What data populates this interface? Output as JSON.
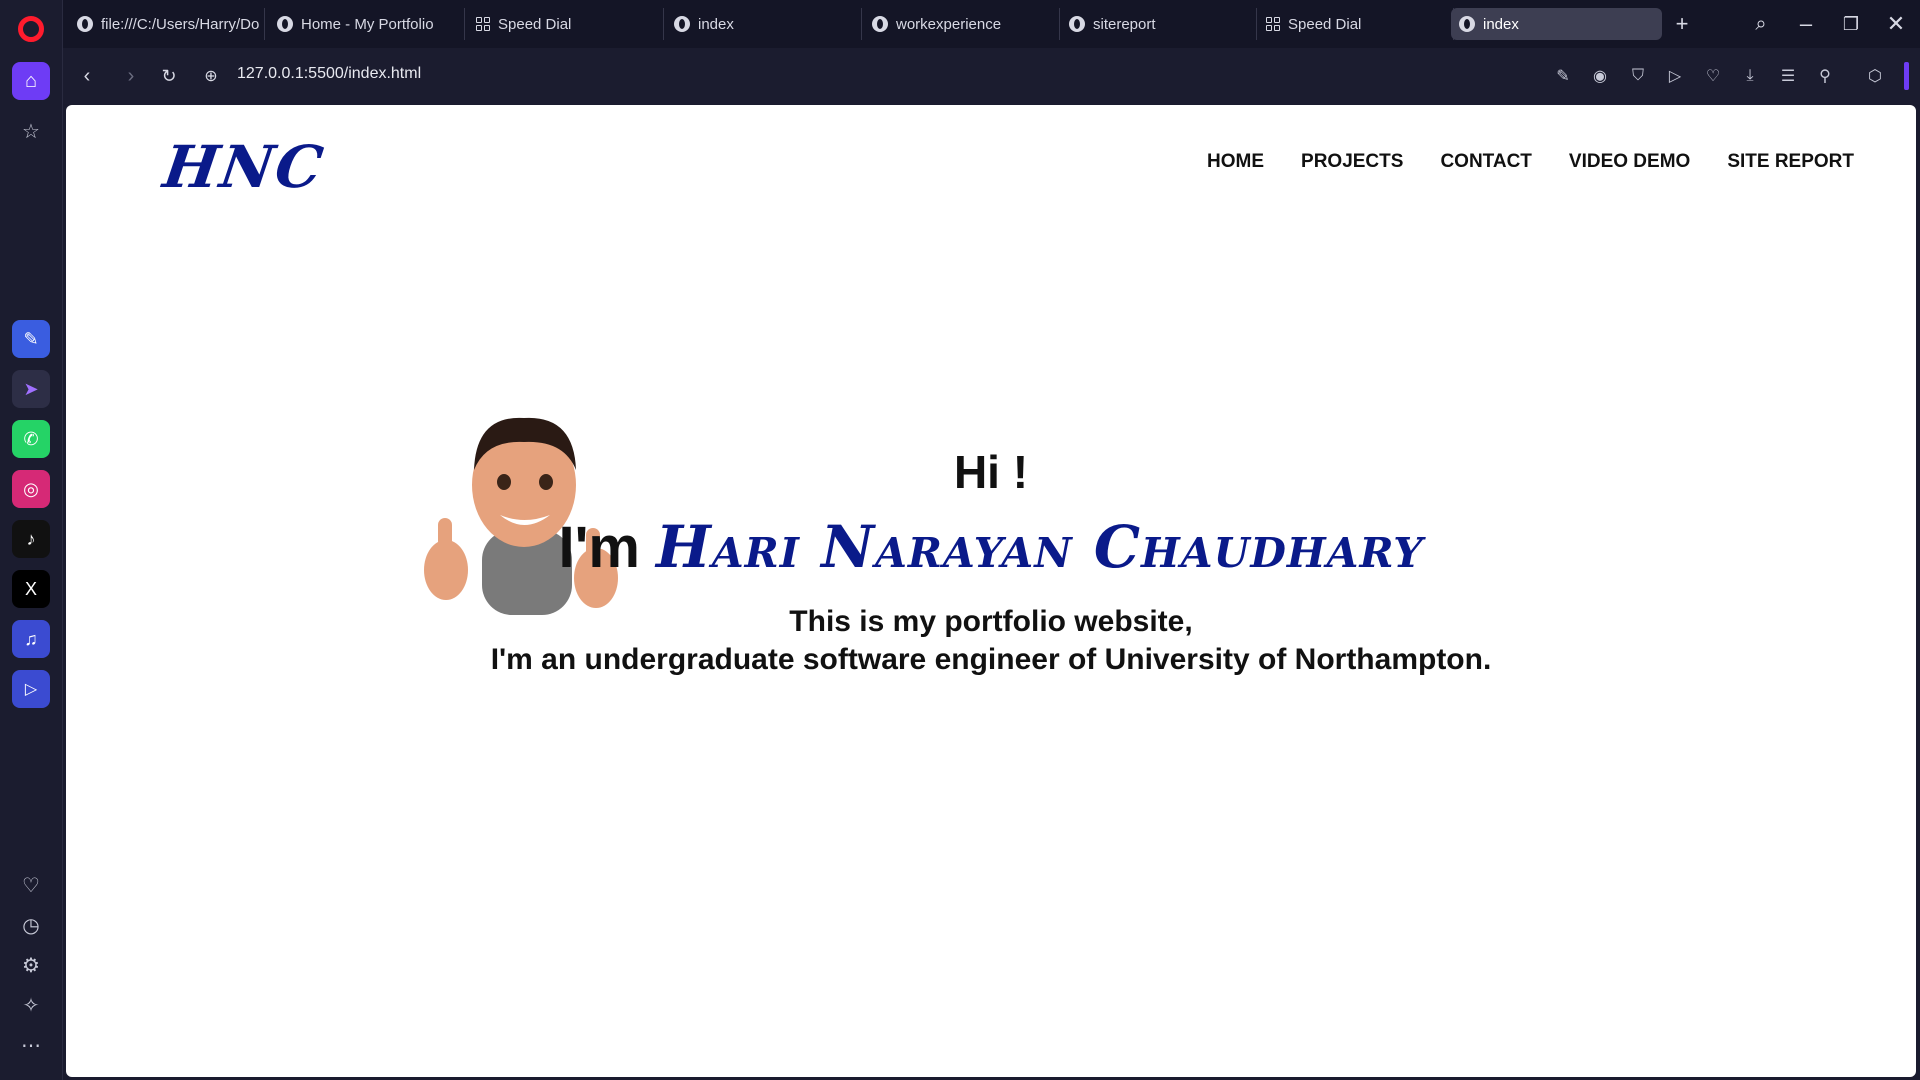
{
  "browser": {
    "tabs": [
      {
        "label": "file:///C:/Users/Harry/Do",
        "icon": "globe-icon"
      },
      {
        "label": "Home - My Portfolio",
        "icon": "globe-icon"
      },
      {
        "label": "Speed Dial",
        "icon": "speed-dial-icon"
      },
      {
        "label": "index",
        "icon": "globe-icon"
      },
      {
        "label": "workexperience",
        "icon": "globe-icon"
      },
      {
        "label": "sitereport",
        "icon": "globe-icon"
      },
      {
        "label": "Speed Dial",
        "icon": "speed-dial-icon"
      },
      {
        "label": "index",
        "icon": "globe-icon",
        "active": true
      }
    ],
    "url": "127.0.0.1:5500/index.html"
  },
  "site": {
    "logo": "HNC",
    "nav": [
      "HOME",
      "PROJECTS",
      "CONTACT",
      "VIDEO DEMO",
      "SITE REPORT"
    ],
    "greeting": "Hi !",
    "im_prefix": "I'm ",
    "name": "Hari Narayan Chaudhary",
    "desc_line1": "This is my portfolio website,",
    "desc_line2": "I'm an undergraduate software engineer of University of Northampton."
  },
  "colors": {
    "accent": "#0a1a8a",
    "sidebar_bg": "#1b1c2f",
    "home_button": "#6e3cf5",
    "opera_red": "#ff1b2d"
  }
}
